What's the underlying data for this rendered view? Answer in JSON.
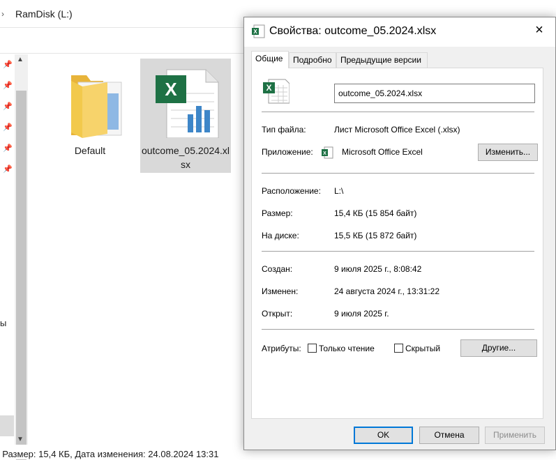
{
  "explorer": {
    "address": "RamDisk (L:)",
    "nav_truncated": "ы",
    "files": [
      {
        "name": "Default",
        "type": "folder"
      },
      {
        "name": "outcome_05.2024.xlsx",
        "type": "excel",
        "selected": true
      }
    ],
    "status": ", Размер: 15,4 КБ, Дата изменения: 24.08.2024 13:31"
  },
  "dialog": {
    "title": "Свойства: outcome_05.2024.xlsx",
    "close_icon": "×",
    "tabs": [
      "Общие",
      "Подробно",
      "Предыдущие версии"
    ],
    "active_tab": "Общие",
    "file_name": "outcome_05.2024.xlsx",
    "file_type_label": "Тип файла:",
    "file_type_value": "Лист Microsoft Office Excel (.xlsx)",
    "app_label": "Приложение:",
    "app_value": "Microsoft Office Excel",
    "change_button": "Изменить...",
    "location_label": "Расположение:",
    "location_value": "L:\\",
    "size_label": "Размер:",
    "size_value": "15,4 КБ (15 854 байт)",
    "disk_label": "На диске:",
    "disk_value": "15,5 КБ (15 872 байт)",
    "created_label": "Создан:",
    "created_value": "9 июля 2025 г., 8:08:42",
    "modified_label": "Изменен:",
    "modified_value": "24 августа 2024 г., 13:31:22",
    "opened_label": "Открыт:",
    "opened_value": "9 июля 2025 г.",
    "attributes_label": "Атрибуты:",
    "readonly_label": "Только чтение",
    "readonly_checked": false,
    "hidden_label": "Скрытый",
    "hidden_checked": false,
    "other_button": "Другие...",
    "ok_button": "OK",
    "cancel_button": "Отмена",
    "apply_button": "Применить"
  },
  "colors": {
    "accent": "#0078d7",
    "excel_green": "#1e7145",
    "folder_yellow": "#f2c94c"
  }
}
